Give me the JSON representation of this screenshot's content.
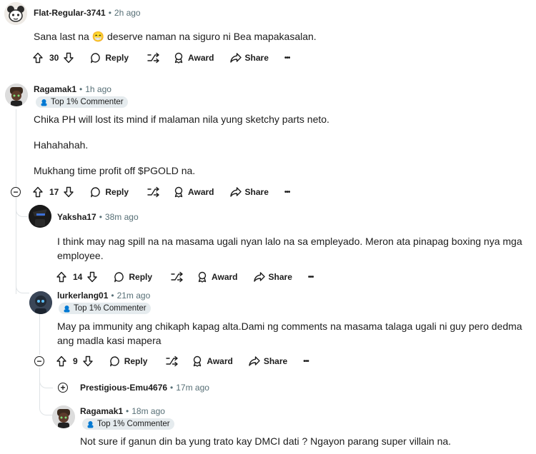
{
  "actions_labels": {
    "reply": "Reply",
    "award": "Award",
    "share": "Share",
    "more": "•••"
  },
  "comments": [
    {
      "user": "Flat-Regular-3741",
      "time": "2h ago",
      "text": "Sana last na 😁 deserve naman na siguro ni Bea mapakasalan.",
      "votes": "30"
    },
    {
      "user": "Ragamak1",
      "time": "1h ago",
      "badge": "Top 1% Commenter",
      "lines": [
        "Chika PH will lost its mind if malaman nila yung sketchy parts neto.",
        "Hahahahah.",
        "Mukhang time profit off $PGOLD na."
      ],
      "votes": "17"
    },
    {
      "user": "Yaksha17",
      "time": "38m ago",
      "text": "I think may nag spill na na masama ugali nyan lalo na sa empleyado. Meron ata pinapag boxing nya mga employee.",
      "votes": "14"
    },
    {
      "user": "lurkerlang01",
      "time": "21m ago",
      "badge": "Top 1% Commenter",
      "text": "May pa immunity ang chikaph kapag alta.Dami ng comments na masama talaga ugali ni guy pero dedma ang madla kasi mapera",
      "votes": "9"
    },
    {
      "user": "Prestigious-Emu4676",
      "time": "17m ago"
    },
    {
      "user": "Ragamak1",
      "time": "18m ago",
      "badge": "Top 1% Commenter",
      "text": "Not sure if ganun din ba yung trato kay DMCI dati ? Ngayon parang super villain na."
    }
  ],
  "colors": {
    "meta": "#576f76",
    "thread_line": "#dfe3e6",
    "badge_bg": "#e5ebee",
    "badge_icon": "#0079d3"
  }
}
